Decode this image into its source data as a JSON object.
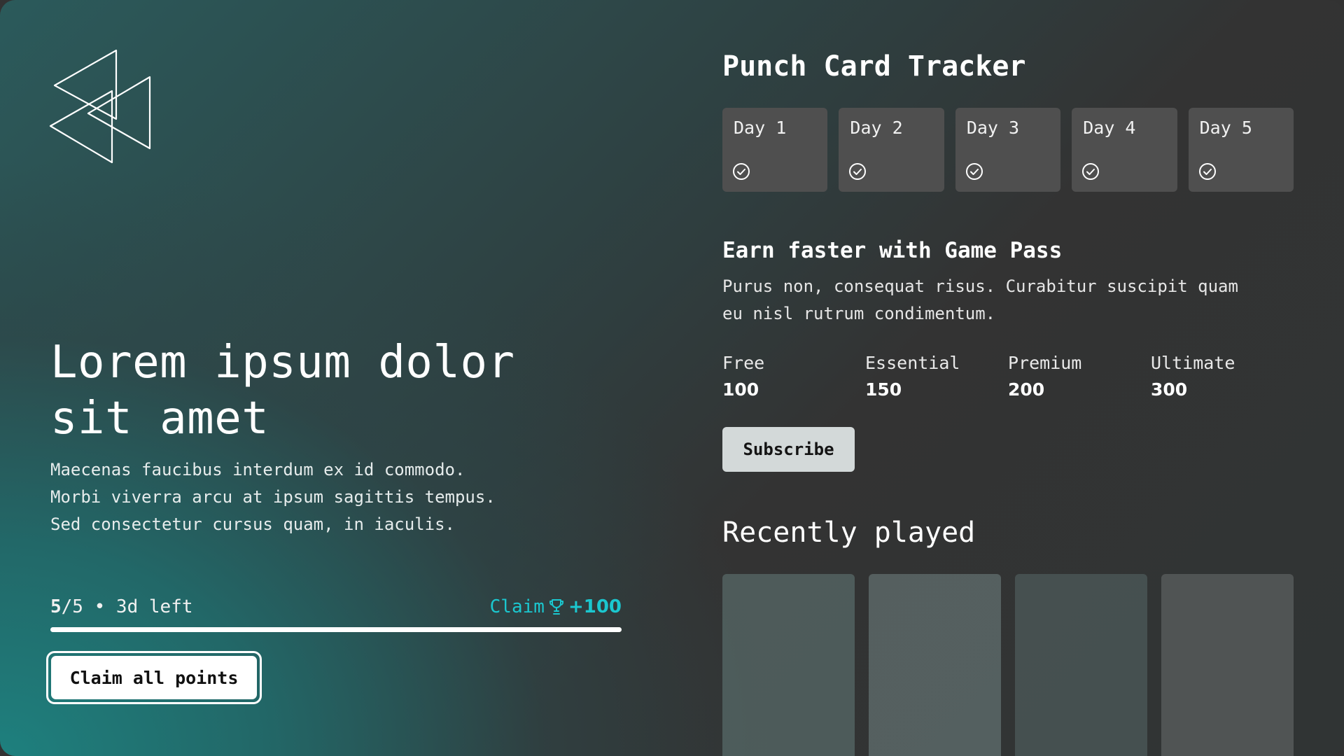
{
  "hero": {
    "logo_icon": "triangles-logo-icon",
    "title_line1": "Lorem ipsum dolor",
    "title_line2": "sit amet",
    "desc_line1": "Maecenas faucibus interdum ex id commodo.",
    "desc_line2": "Morbi viverra arcu at ipsum sagittis tempus.",
    "desc_line3": "Sed consectetur cursus quam, in iaculis.",
    "progress_current": "5",
    "progress_total": "/5",
    "progress_suffix": " • 3d left",
    "progress_fraction": 1.0,
    "claim_label": "Claim",
    "claim_icon": "trophy-icon",
    "claim_points": "+100",
    "claim_all_label": "Claim all points",
    "accent_color": "#1bc7cf"
  },
  "punch_card": {
    "title": "Punch Card Tracker",
    "days": [
      {
        "label": "Day 1",
        "icon": "check-circle-icon"
      },
      {
        "label": "Day 2",
        "icon": "check-circle-icon"
      },
      {
        "label": "Day 3",
        "icon": "check-circle-icon"
      },
      {
        "label": "Day 4",
        "icon": "check-circle-icon"
      },
      {
        "label": "Day 5",
        "icon": "check-circle-icon"
      }
    ]
  },
  "game_pass": {
    "title": "Earn faster with Game Pass",
    "desc_line1": "Purus non, consequat risus. Curabitur suscipit quam",
    "desc_line2": "eu nisl rutrum condimentum.",
    "tiers": [
      {
        "name": "Free",
        "points": "100"
      },
      {
        "name": "Essential",
        "points": "150"
      },
      {
        "name": "Premium",
        "points": "200"
      },
      {
        "name": "Ultimate",
        "points": "300"
      }
    ],
    "subscribe_label": "Subscribe"
  },
  "recent": {
    "title": "Recently played"
  }
}
